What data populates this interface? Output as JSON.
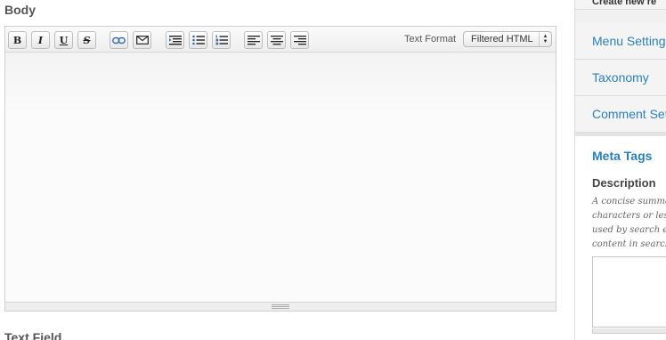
{
  "body": {
    "label": "Body",
    "toolbar": {
      "buttons": [
        {
          "name": "bold-button",
          "glyph": "B"
        },
        {
          "name": "italic-button",
          "glyph": "I"
        },
        {
          "name": "underline-button",
          "glyph": "U"
        },
        {
          "name": "strikethrough-button",
          "glyph": "S"
        },
        {
          "name": "link-button",
          "icon": "link-icon"
        },
        {
          "name": "email-button",
          "icon": "envelope-icon"
        },
        {
          "name": "blockquote-button",
          "icon": "blockquote-icon"
        },
        {
          "name": "bulleted-list-button",
          "icon": "bulleted-list-icon"
        },
        {
          "name": "numbered-list-button",
          "icon": "numbered-list-icon"
        },
        {
          "name": "align-left-button",
          "icon": "align-left-icon"
        },
        {
          "name": "align-center-button",
          "icon": "align-center-icon"
        },
        {
          "name": "align-right-button",
          "icon": "align-right-icon"
        }
      ],
      "text_format_label": "Text Format",
      "text_format_value": "Filtered HTML"
    },
    "content": ""
  },
  "next_field": {
    "label": "Text Field"
  },
  "sidebar": {
    "top_item": "Create new re",
    "items": [
      {
        "label": "Menu Settings"
      },
      {
        "label": "Taxonomy"
      },
      {
        "label": "Comment Settings"
      }
    ],
    "meta_tags": {
      "title": "Meta Tags",
      "description_label": "Description",
      "description_help": [
        "A concise summary",
        "characters or less",
        "used by search en",
        "content in search"
      ],
      "description_value": ""
    }
  },
  "colors": {
    "link": "#2b7fbd",
    "sidebar_bg": "#f1f1f1",
    "editor_bg": "#f9f9f9"
  }
}
